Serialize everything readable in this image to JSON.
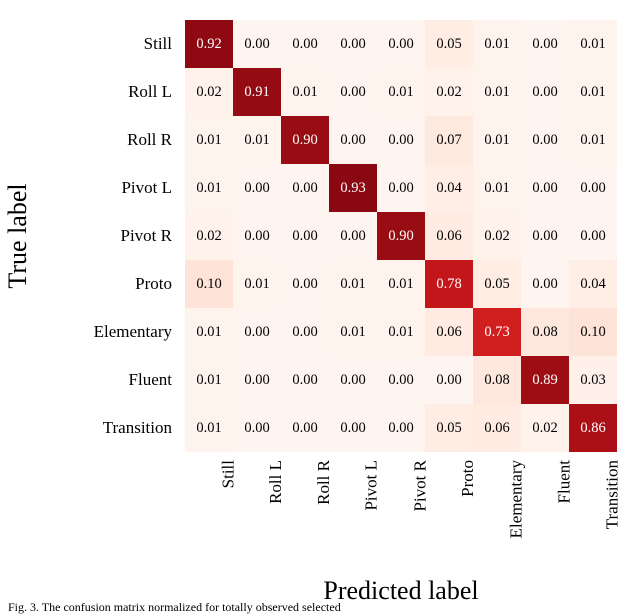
{
  "chart_data": {
    "type": "heatmap",
    "xlabel": "Predicted label",
    "ylabel": "True label",
    "categories": [
      "Still",
      "Roll L",
      "Roll R",
      "Pivot L",
      "Pivot R",
      "Proto",
      "Elementary",
      "Fluent",
      "Transition"
    ],
    "matrix": [
      [
        0.92,
        0.0,
        0.0,
        0.0,
        0.0,
        0.05,
        0.01,
        0.0,
        0.01
      ],
      [
        0.02,
        0.91,
        0.01,
        0.0,
        0.01,
        0.02,
        0.01,
        0.0,
        0.01
      ],
      [
        0.01,
        0.01,
        0.9,
        0.0,
        0.0,
        0.07,
        0.01,
        0.0,
        0.01
      ],
      [
        0.01,
        0.0,
        0.0,
        0.93,
        0.0,
        0.04,
        0.01,
        0.0,
        0.0
      ],
      [
        0.02,
        0.0,
        0.0,
        0.0,
        0.9,
        0.06,
        0.02,
        0.0,
        0.0
      ],
      [
        0.1,
        0.01,
        0.0,
        0.01,
        0.01,
        0.78,
        0.05,
        0.0,
        0.04
      ],
      [
        0.01,
        0.0,
        0.0,
        0.01,
        0.01,
        0.06,
        0.73,
        0.08,
        0.1
      ],
      [
        0.01,
        0.0,
        0.0,
        0.0,
        0.0,
        0.0,
        0.08,
        0.89,
        0.03
      ],
      [
        0.01,
        0.0,
        0.0,
        0.0,
        0.0,
        0.05,
        0.06,
        0.02,
        0.86
      ]
    ],
    "vmin": 0.0,
    "vmax": 1.0,
    "cmap": "Reds"
  },
  "caption": "Fig. 3.   The confusion matrix normalized for totally observed selected"
}
